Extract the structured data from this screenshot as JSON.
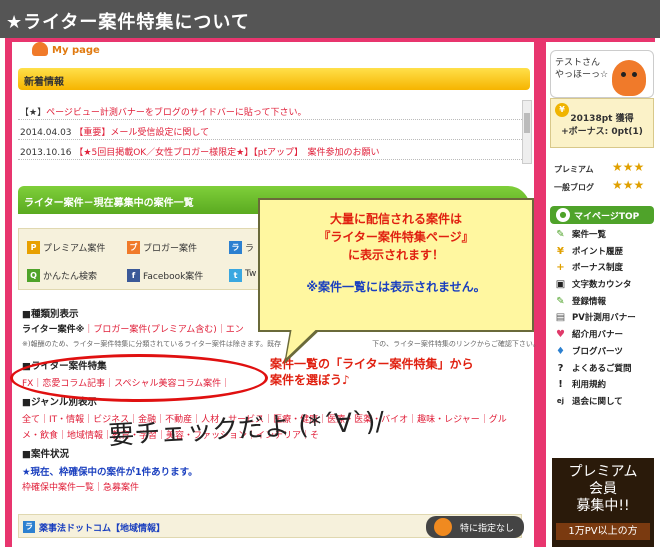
{
  "title": "★ライター案件特集について",
  "mypage": "My page",
  "news": {
    "header": "新着情報",
    "items": [
      {
        "date": "【★】",
        "text": "ページビュー計測バナーをブログのサイドバーに貼って下さい。"
      },
      {
        "date": "2014.04.03",
        "text": "【重要】メール受信設定に関して"
      },
      {
        "date": "2013.10.16",
        "text": "【★5回目掲載OK／女性ブロガー様限定★】【ptアップ】　案件参加のお願い"
      }
    ]
  },
  "cases": {
    "header": "ライター案件－現在募集中の案件一覧",
    "buttons": [
      {
        "icon": "P",
        "label": "プレミアム案件"
      },
      {
        "icon": "ブ",
        "label": "ブロガー案件"
      },
      {
        "icon": "ラ",
        "label": "ラ"
      },
      {
        "icon": "Q",
        "label": "かんたん検索"
      },
      {
        "icon": "f",
        "label": "Facebook案件"
      },
      {
        "icon": "t",
        "label": "Tw"
      }
    ],
    "type_title": "■種類別表示",
    "type_line_label": "ライター案件※",
    "type_line_links": "｜ブロガー案件(プレミアム含む)｜エン",
    "type_note": "※)報酬のため、ライター案件特集に分類されているライター案件は除きます。既存　　　　　　　　　　　　　下の、ライター案件特集のリンクからご確認下さい。",
    "writer_title": "■ライター案件特集",
    "writer_links": "FX｜恋愛コラム記事｜スペシャル美容コラム案件｜",
    "genre_title": "■ジャンル別表示",
    "genre_line1": "全て｜IT・情報｜ビジネス｜金融｜不動産｜人材・サービス｜医療・健康｜医療・医薬・バイオ｜趣味・レジャー｜グル",
    "genre_line2": "メ・飲食｜地域情報｜教育・学習｜美容・ファッション｜インテリア｜そ",
    "status_title": "■案件状況",
    "status_line": "★現在、枠確保中の案件が1件あります。",
    "status_links": "枠確保中案件一覧｜急募案件"
  },
  "callout": {
    "line1": "大量に配信される案件は",
    "line2": "『ライター案件特集ページ』",
    "line3": "に表示されます！",
    "line4": "※案件一覧には表示されません。"
  },
  "annotation_red": {
    "line1": "案件一覧の「ライター案件特集」から",
    "line2": "案件を選ぼう♪"
  },
  "handwrite": "要チェックだよ (*´∀`)/",
  "bottom": {
    "label": "薬事法ドットコム【地域情報】",
    "badge": "特に指定なし"
  },
  "sidebar": {
    "greeting1": "テストさん",
    "greeting2": "やっほーっ☆",
    "points": "20138pt 獲得",
    "bonus": "+ボーナス: 0pt(1)",
    "rank1": "プレミアム",
    "rank2": "一般ブログ",
    "stars1": "★★★",
    "stars2": "★★★",
    "menu_title": "マイページTOP",
    "menu": [
      {
        "icon": "✎",
        "label": "案件一覧"
      },
      {
        "icon": "¥",
        "label": "ポイント履歴"
      },
      {
        "icon": "+",
        "label": "ボーナス制度"
      },
      {
        "icon": "▣",
        "label": "文字数カウンタ"
      },
      {
        "icon": "✎",
        "label": "登録情報"
      },
      {
        "icon": "▤",
        "label": "PV計測用バナー"
      },
      {
        "icon": "♥",
        "label": "紹介用バナー"
      },
      {
        "icon": "♦",
        "label": "ブログパーツ"
      },
      {
        "icon": "?",
        "label": "よくあるご質問"
      },
      {
        "icon": "!",
        "label": "利用規約"
      },
      {
        "icon": "ej",
        "label": "退会に関して"
      }
    ],
    "promo1": "プレミアム",
    "promo2": "会員",
    "promo3": "募集中!!",
    "promo4": "1万PV以上の方"
  }
}
